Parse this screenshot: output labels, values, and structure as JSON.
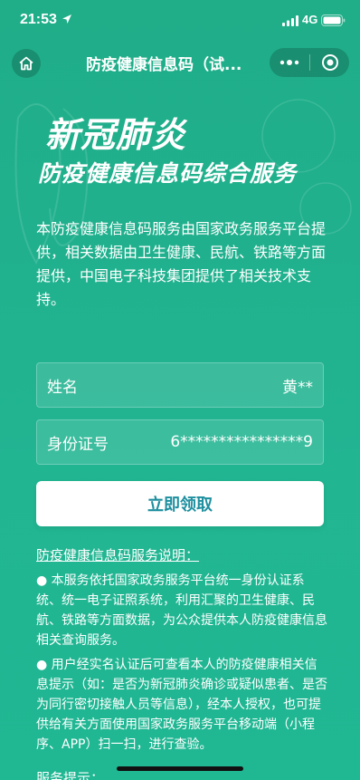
{
  "status_bar": {
    "time": "21:53",
    "network": "4G",
    "icons": [
      "location-arrow-icon",
      "signal-bars-icon",
      "battery-icon"
    ]
  },
  "nav": {
    "title": "防疫健康信息码（试...",
    "icons": [
      "home-icon",
      "more-dots-icon",
      "close-target-icon"
    ]
  },
  "hero": {
    "title": "新冠肺炎",
    "subtitle": "防疫健康信息码综合服务"
  },
  "intro": "本防疫健康信息码服务由国家政务服务平台提供，相关数据由卫生健康、民航、铁路等方面提供，中国电子科技集团提供了相关技术支持。",
  "form": {
    "name_label": "姓名",
    "name_value": "黄**",
    "id_label": "身份证号",
    "id_value": "6****************9"
  },
  "cta_label": "立即领取",
  "notes": {
    "title": "防疫健康信息码服务说明：",
    "items": [
      "● 本服务依托国家政务服务平台统一身份认证系统、统一电子证照系统，利用汇聚的卫生健康、民航、铁路等方面数据，为公众提供本人防疫健康信息相关查询服务。",
      "● 用户经实名认证后可查看本人的防疫健康相关信息提示（如：是否为新冠肺炎确诊或疑似患者、是否为同行密切接触人员等信息），经本人授权，也可提供给有关方面使用国家政务服务平台移动端（小程序、APP）扫一扫，进行查验。"
    ]
  },
  "service_tip": "服务提示：",
  "colors": {
    "background": "#20b08d",
    "button_text": "#1d8f9f",
    "button_bg": "#ffffff"
  }
}
